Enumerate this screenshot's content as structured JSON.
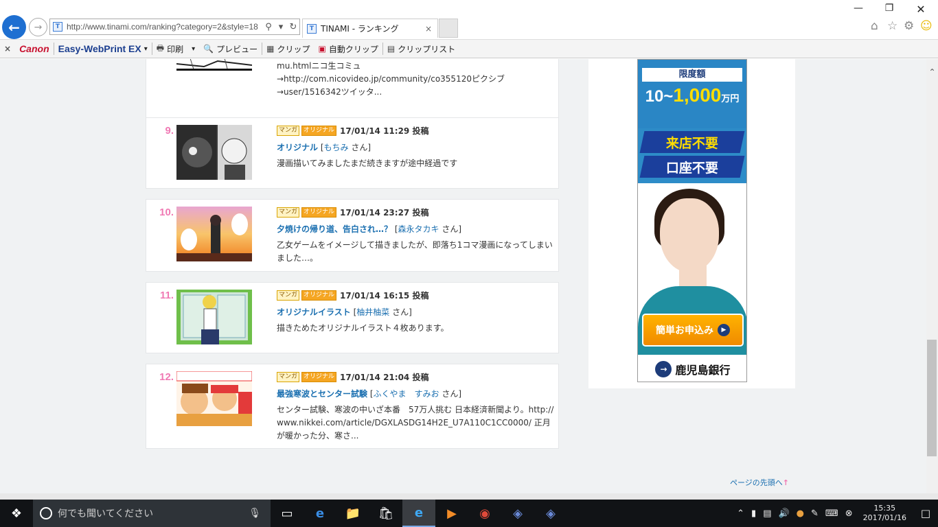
{
  "browser": {
    "url": "http://www.tinami.com/ranking?category=2&style=18",
    "tab_title": "TINAMI - ランキング",
    "tab_close": "×",
    "min": "—",
    "max": "❐",
    "close": "✕"
  },
  "toolbar": {
    "close": "×",
    "canon": "Canon",
    "ewp": "Easy-WebPrint EX",
    "ewp_arrow": "▾",
    "print": "印刷",
    "print_arrow": "▾",
    "preview": "プレビュー",
    "clip": "クリップ",
    "auto_clip": "自動クリップ",
    "clip_list": "クリップリスト"
  },
  "rankings": {
    "top": {
      "desc": "mu.htmlニコ生コミュ\n→http://com.nicovideo.jp/community/co355120ピクシブ\n→user/1516342ツイッタ..."
    },
    "items": [
      {
        "rank": "9.",
        "badge1": "マンガ",
        "badge2": "オリジナル",
        "date": "17/01/14 11:29 投稿",
        "work": "オリジナル",
        "bracket_open": "[",
        "author": "もちみ",
        "san": "さん]",
        "desc": "漫画描いてみましたまだ続きますが途中経過です"
      },
      {
        "rank": "10.",
        "badge1": "マンガ",
        "badge2": "オリジナル",
        "date": "17/01/14 23:27 投稿",
        "work": "夕焼けの帰り道、告白され…？",
        "bracket_open": "[",
        "author": "森永タカキ",
        "san": "さん]",
        "desc": "乙女ゲームをイメージして描きましたが、即落ち1コマ漫画になってしまいました…。"
      },
      {
        "rank": "11.",
        "badge1": "マンガ",
        "badge2": "オリジナル",
        "date": "17/01/14 16:15 投稿",
        "work": "オリジナルイラスト",
        "bracket_open": "[",
        "author": "柚井柚菜",
        "san": "さん]",
        "desc": "描きためたオリジナルイラスト４枚あります。"
      },
      {
        "rank": "12.",
        "badge1": "マンガ",
        "badge2": "オリジナル",
        "date": "17/01/14 21:04 投稿",
        "work": "最強寒波とセンター試験",
        "bracket_open": "[",
        "author": "ふくやま　すみお",
        "san": "さん]",
        "desc": "センター試験、寒波の中いざ本番　57万人挑む 日本経済新聞より。http://www.nikkei.com/article/DGXLASDG14H2E_U7A110C1CC0000/ 正月が暖かった分、寒さ..."
      }
    ]
  },
  "page_top": "ページの先頭へ",
  "ad": {
    "limit_label": "限度額",
    "amount_pre": "10~",
    "amount_hl": "1,000",
    "amount_unit": "万円",
    "feature1": "来店不要",
    "feature2": "口座不要",
    "cta": "簡単お申込み",
    "bank": "鹿児島銀行"
  },
  "taskbar": {
    "search_placeholder": "何でも聞いてください",
    "time": "15:35",
    "date": "2017/01/16"
  },
  "colors": {
    "rank_pink": "#f07ab4",
    "link_blue": "#1a6fb0",
    "ad_blue": "#2a86c5",
    "back_btn": "#1e6fd1"
  }
}
